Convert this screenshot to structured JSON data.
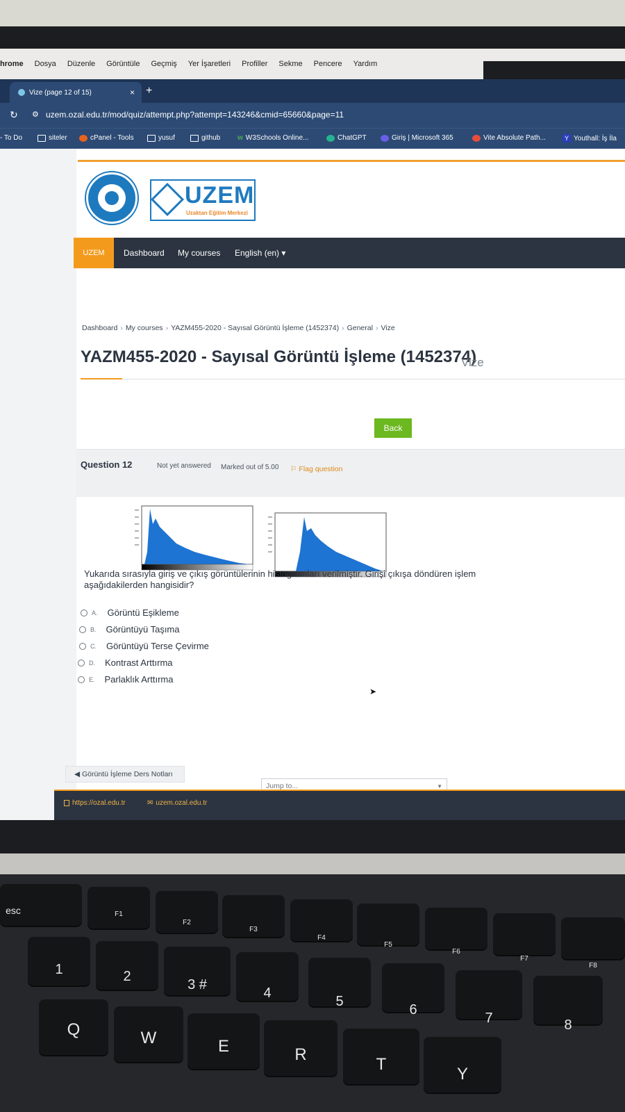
{
  "menubar": {
    "app_name": "hrome",
    "items": [
      "Dosya",
      "Düzenle",
      "Görüntüle",
      "Geçmiş",
      "Yer İşaretleri",
      "Profiller",
      "Sekme",
      "Pencere",
      "Yardım"
    ]
  },
  "tab": {
    "title": "Vize (page 12 of 15)",
    "close": "×",
    "new": "+"
  },
  "address": {
    "url": "uzem.ozal.edu.tr/mod/quiz/attempt.php?attempt=143246&cmid=65660&page=11"
  },
  "bookmarks": [
    "- To Do",
    "siteler",
    "cPanel - Tools",
    "yusuf",
    "github",
    "W3Schools Online...",
    "ChatGPT",
    "Giriş | Microsoft 365",
    "Vite Absolute Path...",
    "Youthall: İş İla"
  ],
  "site": {
    "logo_word": "UZEM",
    "logo_sub": "Uzaktan Eğitim Merkezi",
    "nav": {
      "home": "UZEM",
      "dashboard": "Dashboard",
      "courses": "My courses",
      "language": "English (en) ▾"
    }
  },
  "breadcrumb": [
    "Dashboard",
    "My courses",
    "YAZM455-2020 - Sayısal Görüntü İşleme (1452374)",
    "General",
    "Vize"
  ],
  "page": {
    "title": "YAZM455-2020 - Sayısal Görüntü İşleme (1452374)",
    "subtitle": "Vize",
    "back": "Back"
  },
  "question": {
    "number": "Question 12",
    "state": "Not yet answered",
    "marks": "Marked out of 5.00",
    "flag": "Flag question",
    "text": "Yukarıda sırasıyla giriş ve çıkış görüntülerinin histogramları verilmiştir. Girişi çıkışa döndüren işlem aşağıdakilerden hangisidir?",
    "answers": [
      {
        "letter": "A.",
        "text": "Görüntü Eşikleme"
      },
      {
        "letter": "B.",
        "text": "Görüntüyü Taşıma"
      },
      {
        "letter": "C.",
        "text": "Görüntüyü Terse Çevirme"
      },
      {
        "letter": "D.",
        "text": "Kontrast Arttırma"
      },
      {
        "letter": "E.",
        "text": "Parlaklık Arttırma"
      }
    ]
  },
  "nav_bottom": {
    "prev": "◀ Görüntü İşleme Ders Notları",
    "jump": "Jump to..."
  },
  "footer": {
    "link1": "https://ozal.edu.tr",
    "link2": "uzem.ozal.edu.tr"
  },
  "keyboard": {
    "rows": [
      [
        "esc",
        "F1",
        "F2",
        "F3",
        "F4",
        "F5",
        "F6",
        "F7",
        "F8"
      ],
      [
        "1",
        "2",
        "3 #",
        "4",
        "5",
        "6",
        "7",
        "8"
      ],
      [
        "Q",
        "W",
        "E",
        "R",
        "T",
        "Y"
      ]
    ]
  },
  "colors": {
    "accent": "#f39a1d",
    "nav": "#2b3440",
    "back_btn": "#6cb820",
    "hist_fill": "#1e74d2"
  }
}
